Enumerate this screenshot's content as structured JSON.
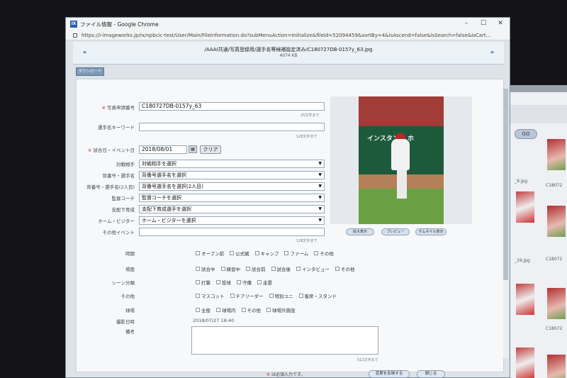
{
  "window": {
    "title": "ファイル情報 - Google Chrome",
    "url": "https://i-imageworks.jp/ix/npbcic-test/User/Main/FileInformation.do?subMenuAction=Initialize&fileId=52094459&sortBy=4&isAscend=false&isSearch=false&isCart...",
    "icon_text": "IX"
  },
  "pathbar": {
    "path": "/AAAI共通/写真登録用/選手名等候補設定済み/C180727DB-0157y_63.jpg",
    "size": "4074 KB",
    "prev": "«",
    "next": "»"
  },
  "toolbar": {
    "download_label": "ダウンロード"
  },
  "form": {
    "photo_number": {
      "label": "写真申請番号",
      "value": "C180727DB-0157y_63",
      "hint": "25文字まで"
    },
    "player_keyword": {
      "label": "選手名キーワード",
      "value": "",
      "hint": "128文字まで"
    },
    "game_date": {
      "label": "試合日・イベント日",
      "value": "2018/08/01",
      "clear_label": "クリア"
    },
    "opponent": {
      "label": "対戦相手",
      "value": "対戦相手を選択"
    },
    "player": {
      "label": "背番号・選手名",
      "value": "背番号選手名を選択"
    },
    "player2": {
      "label": "背番号・選手名(2人目)",
      "value": "背番号選手名を選択(2人目)"
    },
    "coach": {
      "label": "監督コーチ",
      "value": "監督コーチを選択"
    },
    "farm": {
      "label": "支配下育成",
      "value": "支配下育成選手を選択"
    },
    "home_visitor": {
      "label": "ホーム・ビジター",
      "value": "ホーム・ビジターを選択"
    },
    "other_event": {
      "label": "その他イベント",
      "value": "",
      "hint": "128文字まで"
    },
    "period": {
      "label": "時期",
      "options": [
        "オープン前",
        "公式戦",
        "キャンプ",
        "ファーム",
        "その他"
      ]
    },
    "scene": {
      "label": "場面",
      "options": [
        "試合中",
        "練習中",
        "試合前",
        "試合後",
        "インタビュー",
        "その他"
      ]
    },
    "scene_type": {
      "label": "シーン分類",
      "options": [
        "打撃",
        "投球",
        "守備",
        "走塁"
      ]
    },
    "other": {
      "label": "その他",
      "options": [
        "マスコット",
        "チアリーダー",
        "特別ユニ",
        "客席・スタンド"
      ]
    },
    "stadium": {
      "label": "球場",
      "options": [
        "全般",
        "球場内",
        "その他",
        "球場外施設"
      ]
    },
    "shot_datetime": {
      "label": "撮影日時",
      "value": "2018/07/27 18:40"
    },
    "remarks": {
      "label": "備考",
      "hint": "512文字まで"
    },
    "required_note": "は必須入力です。",
    "required_mark": "※",
    "save_label": "変更を反映する",
    "close_label": "閉じる"
  },
  "photo": {
    "sign_text": "インスタント ホ",
    "buttons": [
      "拡大表示",
      "プレビュー",
      "サムネイル表示"
    ]
  },
  "background": {
    "go_label": "GO",
    "labels": [
      "C18072",
      "_9.jpg",
      "C18072",
      "_19.jpg",
      "C18072"
    ]
  }
}
